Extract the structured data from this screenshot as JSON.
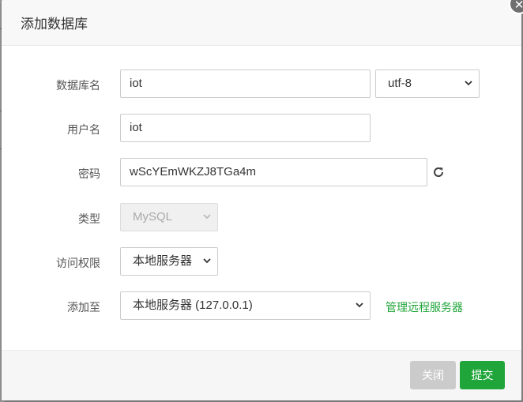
{
  "dialog": {
    "title": "添加数据库",
    "close_icon": "close-icon"
  },
  "form": {
    "db_name": {
      "label": "数据库名",
      "value": "iot"
    },
    "charset": {
      "value": "utf-8"
    },
    "username": {
      "label": "用户名",
      "value": "iot"
    },
    "password": {
      "label": "密码",
      "value": "wScYEmWKZJ8TGa4m",
      "refresh_icon": "refresh-icon"
    },
    "type": {
      "label": "类型",
      "value": "MySQL",
      "disabled": true
    },
    "access": {
      "label": "访问权限",
      "value": "本地服务器"
    },
    "add_to": {
      "label": "添加至",
      "value": "本地服务器 (127.0.0.1)",
      "link": "管理远程服务器"
    }
  },
  "footer": {
    "close_label": "关闭",
    "submit_label": "提交"
  },
  "colors": {
    "accent": "#20a53a",
    "disabled_button": "#cbcbcb"
  }
}
